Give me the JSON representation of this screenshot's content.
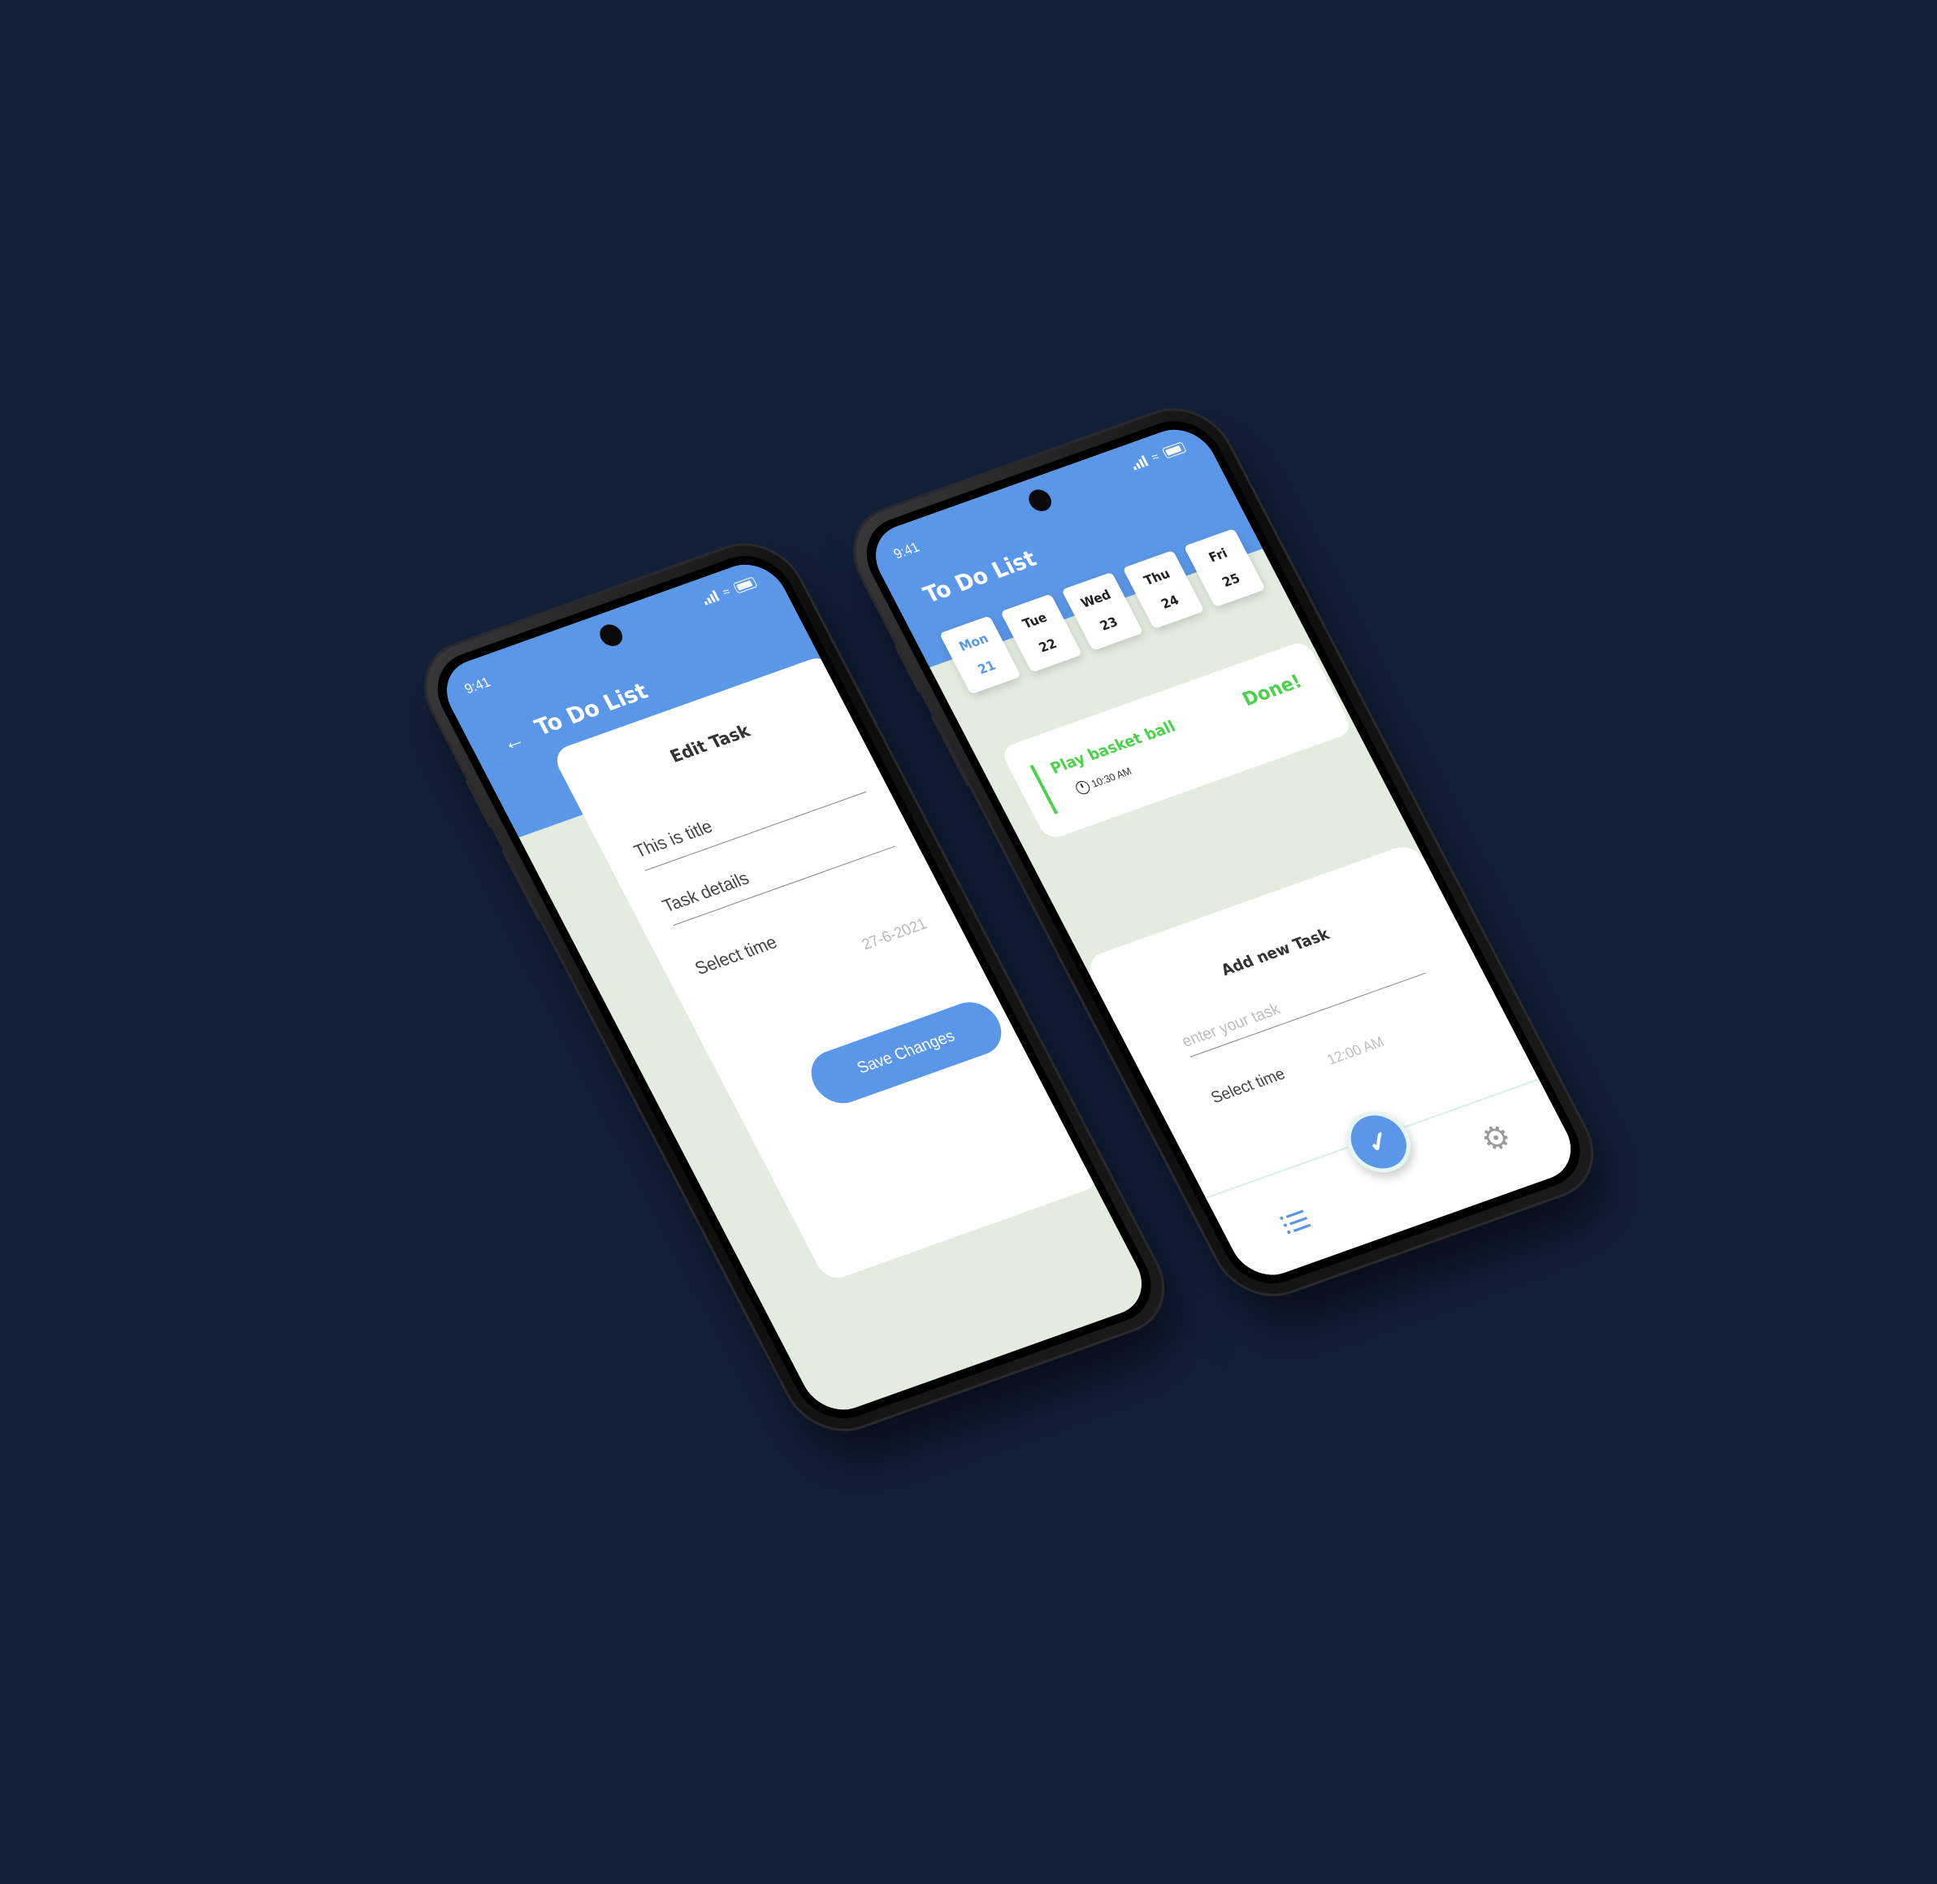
{
  "left_phone": {
    "status_time": "9:41",
    "app_title": "To Do List",
    "card_title": "Edit Task",
    "title_value": "This is title",
    "details_value": "Task details",
    "select_time_label": "Select time",
    "date_value": "27-6-2021",
    "save_label": "Save Changes"
  },
  "right_phone": {
    "status_time": "9:41",
    "app_title": "To Do List",
    "days": [
      {
        "name": "Mon",
        "num": "21"
      },
      {
        "name": "Tue",
        "num": "22"
      },
      {
        "name": "Wed",
        "num": "23"
      },
      {
        "name": "Thu",
        "num": "24"
      },
      {
        "name": "Fri",
        "num": "25"
      }
    ],
    "task": {
      "name": "Play basket ball",
      "time": "10:30 AM",
      "status": "Done!"
    },
    "add_title": "Add new Task",
    "add_placeholder": "enter your task",
    "select_time_label": "Select time",
    "select_time_value": "12:00 AM"
  },
  "colors": {
    "background": "#13203a",
    "primary": "#5b97e8",
    "success": "#4dd04d",
    "screen_bg": "#e3ecdf"
  }
}
